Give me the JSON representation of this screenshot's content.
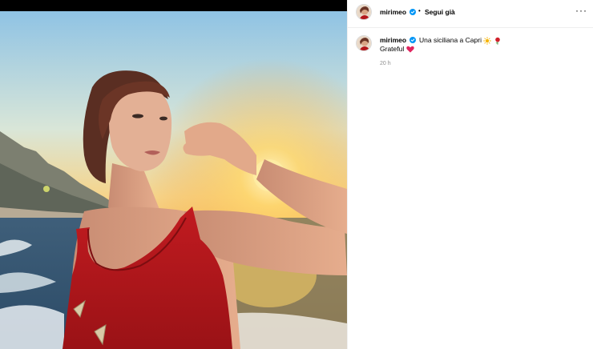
{
  "post": {
    "username": "mirimeo",
    "follow_separator": "•",
    "follow_label": "Segui già",
    "more_icon": "more-horizontal-icon",
    "caption": {
      "text": "Una siciliana a Capri",
      "emojis": [
        "sun-icon",
        "rose-icon"
      ],
      "line2": "Grateful",
      "line2_emoji": "red-heart-icon"
    },
    "timestamp": "20 h"
  },
  "colors": {
    "verified": "#0095f6",
    "muted": "#8e8e8e",
    "dress": "#b3161b",
    "heart": "#e0245e"
  }
}
